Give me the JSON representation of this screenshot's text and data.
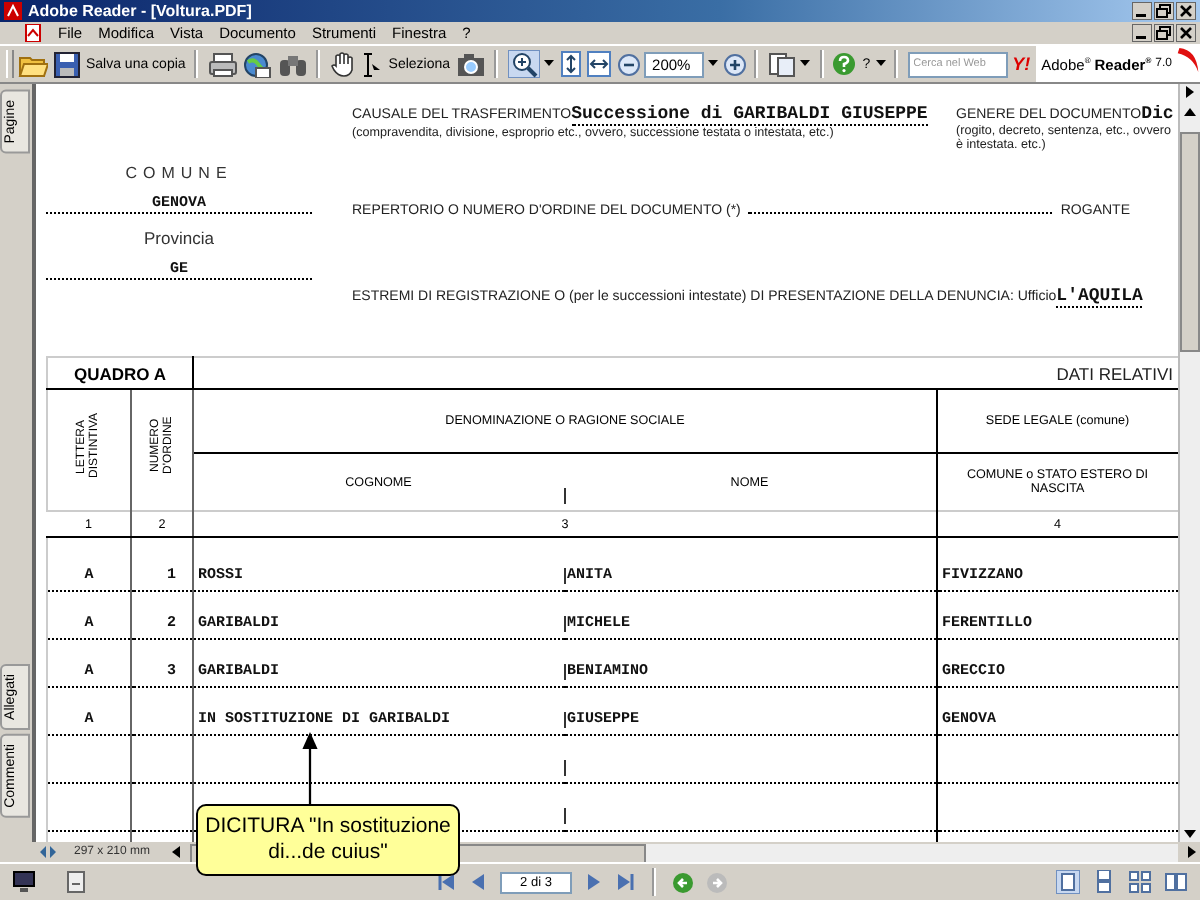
{
  "window": {
    "title": "Adobe Reader - [Voltura.PDF]"
  },
  "menu": [
    "File",
    "Modifica",
    "Vista",
    "Documento",
    "Strumenti",
    "Finestra",
    "?"
  ],
  "toolbar": {
    "save_label": "Salva una copia",
    "select_label": "Seleziona",
    "zoom": "200%",
    "help_label": "?",
    "search_placeholder": "Cerca nel Web",
    "search_logo": "Y!",
    "brand": "Adobe$^{®}$",
    "product": "Reader$^{®}$",
    "version": "7.0"
  },
  "side_tabs": [
    {
      "label": "Pagine"
    },
    {
      "label": "Allegati"
    },
    {
      "label": "Commenti"
    }
  ],
  "document": {
    "comune_label": "COMUNE",
    "comune": "GENOVA",
    "provincia_label": "Provincia",
    "provincia": "GE",
    "causale_label": "CAUSALE DEL TRASFERIMENTO",
    "causale_value": "Successione di GARIBALDI GIUSEPPE",
    "causale_hint": "(compravendita, divisione, esproprio etc., ovvero, successione testata o intestata, etc.)",
    "genere_label": "GENERE DEL DOCUMENTO",
    "genere_value": "Dic",
    "genere_hint": "(rogito, decreto, sentenza, etc., ovvero",
    "genere_hint_2": "è intestata. etc.)",
    "repertorio_label": "REPERTORIO O NUMERO D'ORDINE DEL DOCUMENTO (*)",
    "rogante_label": "ROGANTE",
    "estremi_label": "ESTREMI DI REGISTRAZIONE O (per  le successioni intestate) DI PRESENTAZIONE DELLA DENUNCIA: Ufficio",
    "estremi_value": "L'AQUILA",
    "table": {
      "title": "QUADRO A",
      "subtitle": "DATI RELATIVI",
      "columns": {
        "lettera": "LETTERA DISTINTIVA",
        "numero": "NUMERO D'ORDINE",
        "denominazione": "DENOMINAZIONE O RAGIONE SOCIALE",
        "sede": "SEDE LEGALE (comune)",
        "cognome": "COGNOME",
        "nome": "NOME",
        "comune": "COMUNE o STATO ESTERO DI NASCITA"
      },
      "column_numbers": [
        "1",
        "2",
        "3",
        "4"
      ],
      "rows": [
        {
          "lettera": "A",
          "numero": "1",
          "cognome": "ROSSI",
          "nome": "ANITA",
          "comune": "FIVIZZANO"
        },
        {
          "lettera": "A",
          "numero": "2",
          "cognome": "GARIBALDI",
          "nome": "MICHELE",
          "comune": "FERENTILLO"
        },
        {
          "lettera": "A",
          "numero": "3",
          "cognome": "GARIBALDI",
          "nome": "BENIAMINO",
          "comune": "GRECCIO"
        },
        {
          "lettera": "A",
          "cognome": "IN SOSTITUZIONE DI GARIBALDI",
          "nome": "GIUSEPPE",
          "comune": "GENOVA"
        }
      ]
    }
  },
  "status_bar": {
    "page_size": "297 x 210 mm",
    "page": "2 di 3"
  },
  "callout": {
    "text": "DICITURA \"In sostituzione di...de cuius\""
  }
}
